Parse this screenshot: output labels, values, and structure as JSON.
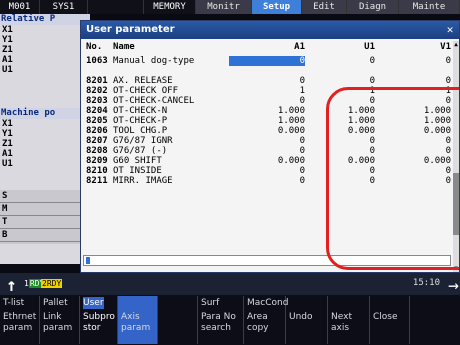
{
  "topbar": {
    "cells": [
      "M001",
      "SYS1",
      "",
      "MEMORY"
    ],
    "modes": [
      {
        "label": "Monitr",
        "active": false
      },
      {
        "label": "Setup",
        "active": true
      },
      {
        "label": "Edit",
        "active": false
      },
      {
        "label": "Diagn",
        "active": false
      },
      {
        "label": "Mainte",
        "active": false
      }
    ]
  },
  "background": {
    "relative_label": "Relative P",
    "relative_axes": [
      "X1",
      "Y1",
      "Z1",
      "A1",
      "U1"
    ],
    "machine_label": "Machine po",
    "machine_axes": [
      "X1",
      "Y1",
      "Z1",
      "A1",
      "U1"
    ],
    "sm": [
      "S",
      "M",
      "T",
      "B"
    ]
  },
  "dialog": {
    "title": "User parameter",
    "close": "✕",
    "headers": {
      "no": "No.",
      "name": "Name",
      "a1": "A1",
      "u1": "U1",
      "v1": "V1"
    },
    "rows": [
      {
        "no": "1063",
        "name": "Manual dog-type",
        "a1": "0",
        "u1": "0",
        "v1": "0",
        "selected": true
      },
      {
        "no": "",
        "name": "",
        "a1": "",
        "u1": "",
        "v1": ""
      },
      {
        "no": "8201",
        "name": "AX. RELEASE",
        "a1": "0",
        "u1": "0",
        "v1": "0"
      },
      {
        "no": "8202",
        "name": "OT-CHECK OFF",
        "a1": "1",
        "u1": "1",
        "v1": "1"
      },
      {
        "no": "8203",
        "name": "OT-CHECK-CANCEL",
        "a1": "0",
        "u1": "0",
        "v1": "0"
      },
      {
        "no": "8204",
        "name": "OT-CHECK-N",
        "a1": "1.000",
        "u1": "1.000",
        "v1": "1.000"
      },
      {
        "no": "8205",
        "name": "OT-CHECK-P",
        "a1": "1.000",
        "u1": "1.000",
        "v1": "1.000"
      },
      {
        "no": "8206",
        "name": "TOOL CHG.P",
        "a1": "0.000",
        "u1": "0.000",
        "v1": "0.000"
      },
      {
        "no": "8207",
        "name": "G76/87 IGNR",
        "a1": "0",
        "u1": "0",
        "v1": "0"
      },
      {
        "no": "8208",
        "name": "G76/87 (-)",
        "a1": "0",
        "u1": "0",
        "v1": "0"
      },
      {
        "no": "8209",
        "name": "G60 SHIFT",
        "a1": "0.000",
        "u1": "0.000",
        "v1": "0.000"
      },
      {
        "no": "8210",
        "name": "OT INSIDE",
        "a1": "0",
        "u1": "0",
        "v1": "0"
      },
      {
        "no": "8211",
        "name": "MIRR. IMAGE",
        "a1": "0",
        "u1": "0",
        "v1": "0"
      }
    ]
  },
  "status": {
    "rdy1_num": "1",
    "rdy1": "RDY",
    "rdy2_num": "2",
    "rdy2": "RDY",
    "time": "15:10"
  },
  "softkeys": [
    {
      "top": "T-list",
      "bottom": "Ethrnet\nparam",
      "active": false
    },
    {
      "top": "Pallet",
      "bottom": "Link\nparam",
      "active": false
    },
    {
      "top": "User",
      "bottom": "Subpro\nstor",
      "active": true
    },
    {
      "top": "",
      "bottom": "Axis\nparam",
      "active": false,
      "blue": true
    },
    {
      "top": "",
      "bottom": "",
      "active": false
    },
    {
      "top": "Surf",
      "bottom": "Para No\nsearch",
      "active": false
    },
    {
      "top": "MacCond",
      "bottom": "Area\ncopy",
      "active": false
    },
    {
      "top": "",
      "bottom": "Undo",
      "active": false
    },
    {
      "top": "",
      "bottom": "Next\naxis",
      "active": false
    },
    {
      "top": "",
      "bottom": "Close",
      "active": false
    }
  ]
}
